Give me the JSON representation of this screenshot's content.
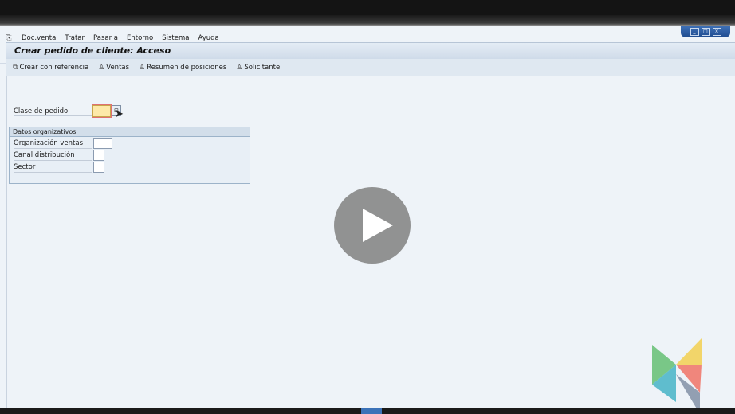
{
  "menu": {
    "items": [
      "Doc.venta",
      "Tratar",
      "Pasar a",
      "Entorno",
      "Sistema",
      "Ayuda"
    ]
  },
  "toolbar": {
    "command_field_value": "",
    "icons": [
      "enter-icon",
      "back-icon",
      "save-icon",
      "green-back-icon",
      "exit-icon",
      "cancel-icon",
      "print-icon",
      "find-icon",
      "find-next-icon",
      "first-page-icon",
      "prev-page-icon",
      "next-page-icon",
      "last-page-icon",
      "create-session-icon",
      "shortcut-icon",
      "help-icon",
      "layout-icon"
    ]
  },
  "title": "Crear pedido de cliente: Acceso",
  "app_toolbar": {
    "buttons": [
      {
        "label": "Crear con referencia",
        "icon": "copy-icon"
      },
      {
        "label": "Ventas",
        "icon": "person-icon"
      },
      {
        "label": "Resumen de posiciones",
        "icon": "person-icon"
      },
      {
        "label": "Solicitante",
        "icon": "person-icon"
      }
    ]
  },
  "form": {
    "clase_label": "Clase de pedido",
    "clase_value": "",
    "group_title": "Datos organizativos",
    "fields": [
      {
        "label": "Organización ventas",
        "value": ""
      },
      {
        "label": "Canal distribución",
        "value": ""
      },
      {
        "label": "Sector",
        "value": ""
      }
    ]
  },
  "colors": {
    "accent": "#3b72b8",
    "required_field": "#fde9a8",
    "play_button": "#808080"
  }
}
